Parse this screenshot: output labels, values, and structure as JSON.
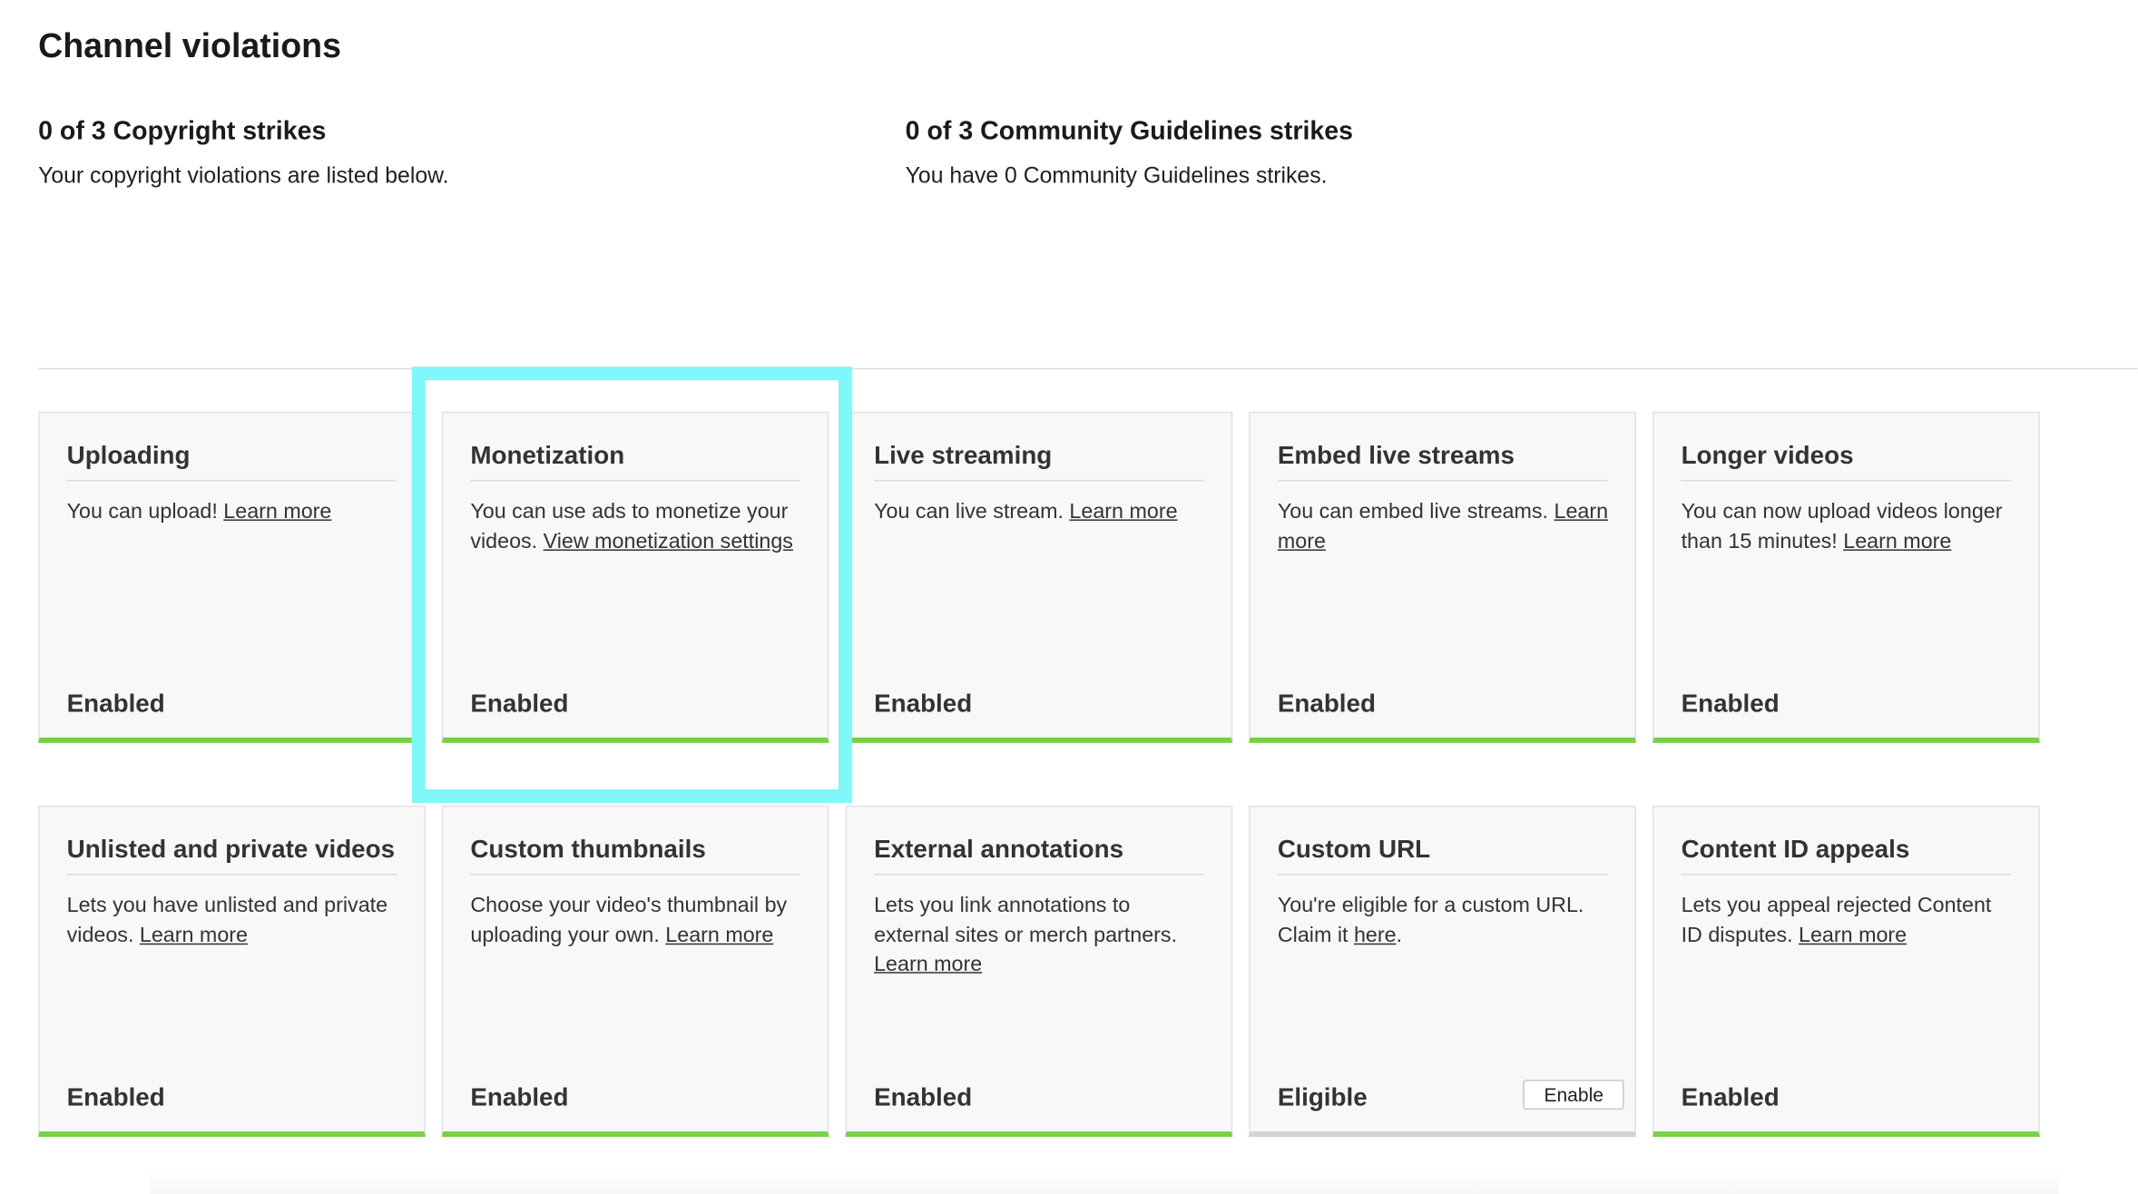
{
  "page": {
    "title": "Channel violations"
  },
  "strikes": {
    "copyright": {
      "title": "0 of 3 Copyright strikes",
      "description": "Your copyright violations are listed below."
    },
    "community": {
      "title": "0 of 3 Community Guidelines strikes",
      "description": "You have 0 Community Guidelines strikes."
    }
  },
  "features": [
    {
      "title": "Uploading",
      "text": "You can upload! ",
      "link": "Learn more",
      "after": "",
      "status": "Enabled"
    },
    {
      "title": "Monetization",
      "text": "You can use ads to monetize your videos. ",
      "link": "View monetization settings",
      "after": "",
      "status": "Enabled"
    },
    {
      "title": "Live streaming",
      "text": "You can live stream. ",
      "link": "Learn more",
      "after": "",
      "status": "Enabled"
    },
    {
      "title": "Embed live streams",
      "text": "You can embed live streams. ",
      "link": "Learn more",
      "after": "",
      "status": "Enabled"
    },
    {
      "title": "Longer videos",
      "text": "You can now upload videos longer than 15 minutes! ",
      "link": "Learn more",
      "after": "",
      "status": "Enabled"
    },
    {
      "title": "Unlisted and private videos",
      "text": "Lets you have unlisted and private videos. ",
      "link": "Learn more",
      "after": "",
      "status": "Enabled"
    },
    {
      "title": "Custom thumbnails",
      "text": "Choose your video's thumbnail by uploading your own. ",
      "link": "Learn more",
      "after": "",
      "status": "Enabled"
    },
    {
      "title": "External annotations",
      "text": "Lets you link annotations to external sites or merch partners. ",
      "link": "Learn more",
      "after": "",
      "status": "Enabled"
    },
    {
      "title": "Custom URL",
      "text": "You're eligible for a custom URL. Claim it ",
      "link": "here",
      "after": ".",
      "status": "Eligible",
      "button": "Enable"
    },
    {
      "title": "Content ID appeals",
      "text": "Lets you appeal rejected Content ID disputes. ",
      "link": "Learn more",
      "after": "",
      "status": "Enabled"
    }
  ],
  "colors": {
    "enabled_bar": "#76d048",
    "eligible_bar": "#d4d4d4",
    "highlight": "#7ff7fb"
  }
}
